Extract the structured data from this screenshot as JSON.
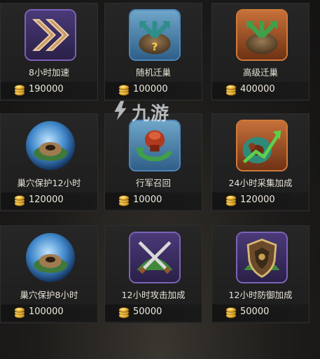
{
  "items": [
    {
      "label": "8小时加速",
      "price": "190000",
      "icon": "speedup-icon"
    },
    {
      "label": "随机迁巢",
      "price": "100000",
      "icon": "random-relocate-icon"
    },
    {
      "label": "高级迁巢",
      "price": "400000",
      "icon": "advanced-relocate-icon"
    },
    {
      "label": "巢穴保护12小时",
      "price": "120000",
      "icon": "nest-shield-12h-icon"
    },
    {
      "label": "行军召回",
      "price": "10000",
      "icon": "march-recall-icon"
    },
    {
      "label": "24小时采集加成",
      "price": "120000",
      "icon": "gather-boost-icon"
    },
    {
      "label": "巢穴保护8小时",
      "price": "100000",
      "icon": "nest-shield-8h-icon"
    },
    {
      "label": "12小时攻击加成",
      "price": "50000",
      "icon": "attack-boost-icon"
    },
    {
      "label": "12小时防御加成",
      "price": "50000",
      "icon": "defense-boost-icon"
    }
  ],
  "currency_icon": "gold-coin-stack-icon",
  "watermark": "九游",
  "colors": {
    "card_bg": "#222222",
    "label": "#e7e2d6",
    "purple_frame": "#6a4fa8",
    "blue_frame": "#3d6fa0",
    "orange_frame": "#b0622a"
  }
}
